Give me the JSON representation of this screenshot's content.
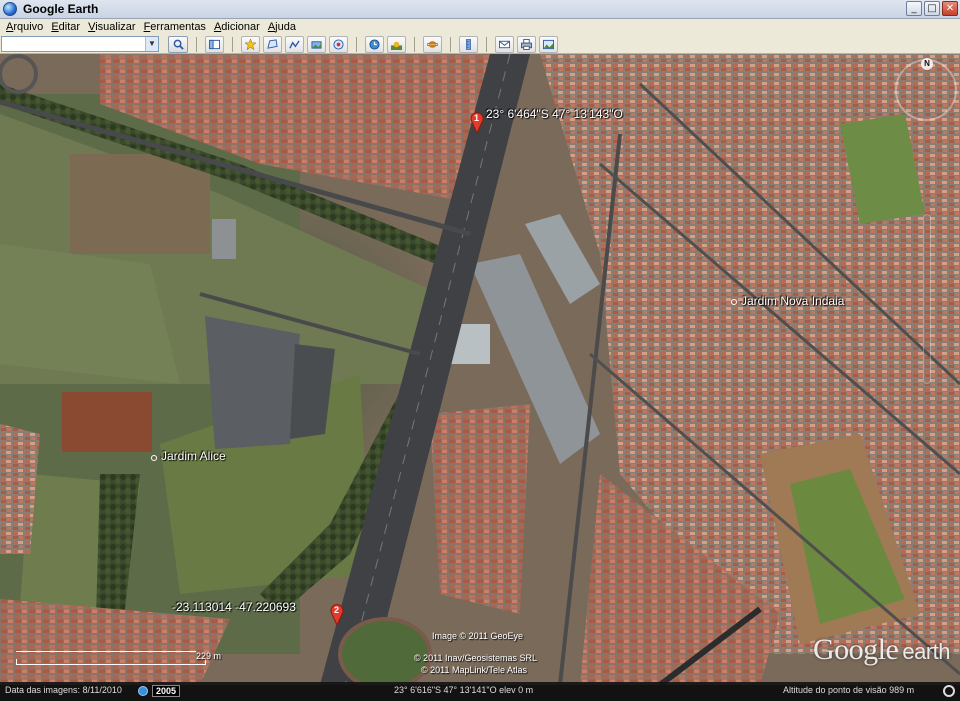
{
  "window": {
    "title": "Google Earth",
    "minimize": "_",
    "maximize": "□",
    "close": "✕"
  },
  "menu": [
    "Arquivo",
    "Editar",
    "Visualizar",
    "Ferramentas",
    "Adicionar",
    "Ajuda"
  ],
  "search": {
    "value": "",
    "placeholder": ""
  },
  "toolbar_icons": [
    "sidebar-icon",
    "placemark-icon",
    "polygon-icon",
    "path-icon",
    "image-overlay-icon",
    "record-tour-icon",
    "historical-imagery-icon",
    "sunlight-icon",
    "planets-icon",
    "ruler-icon",
    "email-icon",
    "print-icon",
    "save-image-icon"
  ],
  "map": {
    "places": [
      {
        "name": "Jardim Nova Indaia"
      },
      {
        "name": "Jardim Alice"
      }
    ],
    "placemarks": [
      {
        "number": "1",
        "label": "23° 6'464\"S  47° 13'143\"O"
      },
      {
        "number": "2",
        "label": "-23.113014  -47.220693"
      }
    ],
    "credits": [
      "Image © 2011 GeoEye",
      "© 2011 Inav/Geosistemas SRL",
      "© 2011 MapLink/Tele Atlas"
    ],
    "watermark": {
      "word1": "Google",
      "word2": "earth"
    },
    "compass": "N",
    "scale": "229 m"
  },
  "status": {
    "date_label": "Data das imagens: 8/11/2010",
    "year": "2005",
    "cursor": "23° 6'616\"S  47° 13'141\"O  elev   0 m",
    "eye_alt": "Altitude do ponto de visão    989 m"
  }
}
